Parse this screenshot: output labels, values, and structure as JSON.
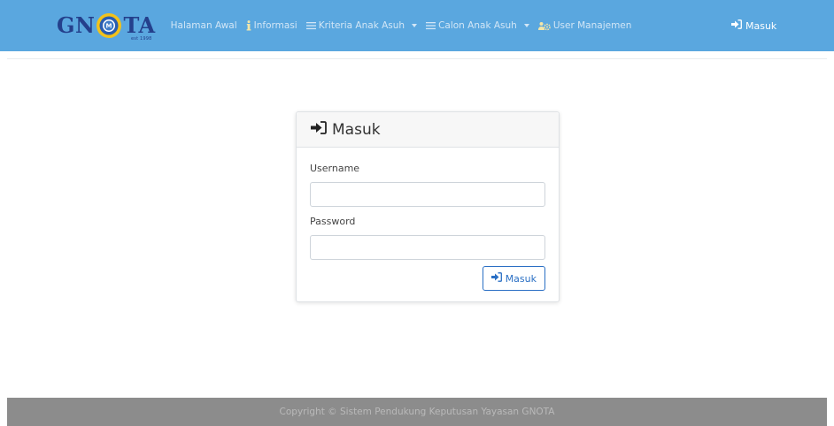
{
  "brand": {
    "name_left": "GN",
    "name_right": "TA",
    "emblem_letter": "M",
    "est": "est 1998"
  },
  "nav": {
    "items": [
      {
        "label": "Halaman Awal",
        "icon": "none"
      },
      {
        "label": "Informasi",
        "icon": "info-icon"
      },
      {
        "label": "Kriteria Anak Asuh",
        "icon": "list-icon",
        "dropdown": true
      },
      {
        "label": "Calon Anak Asuh",
        "icon": "list-icon",
        "dropdown": true
      },
      {
        "label": "User Manajemen",
        "icon": "users-cog-icon"
      }
    ],
    "login_label": "Masuk"
  },
  "login_card": {
    "title": "Masuk",
    "username_label": "Username",
    "username_value": "",
    "password_label": "Password",
    "password_value": "",
    "submit_label": "Masuk"
  },
  "footer": {
    "text": "Copyright © Sistem Pendukung Keputusan Yayasan GNOTA"
  },
  "colors": {
    "navbar_bg": "#5aa7df",
    "brand_text": "#24408c",
    "primary": "#2a6fc4",
    "footer_bg": "#8c8c8c"
  }
}
